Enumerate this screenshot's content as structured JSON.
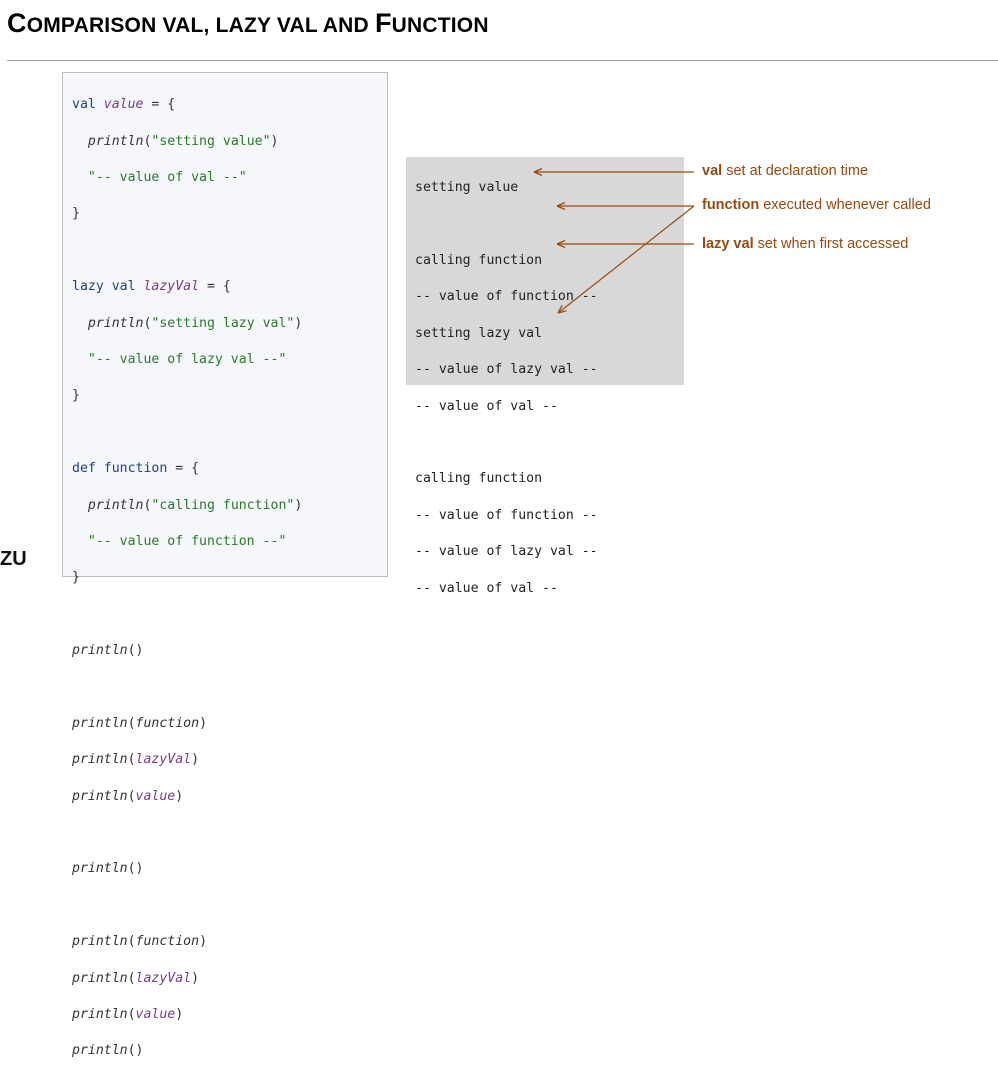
{
  "title": {
    "first": "C",
    "rest1": "OMPARISON VAL, LAZY VAL AND ",
    "mid": "F",
    "rest2": "UNCTION"
  },
  "code": {
    "val_decl": {
      "kw": "val",
      "name": "value",
      "eq": " = {"
    },
    "val_print": {
      "fn": "println",
      "arg": "\"setting value\""
    },
    "val_str": "\"-- value of val --\"",
    "lazy_decl": {
      "kw": "lazy val",
      "name": "lazyVal",
      "eq": " = {"
    },
    "lazy_print": {
      "fn": "println",
      "arg": "\"setting lazy val\""
    },
    "lazy_str": "\"-- value of lazy val --\"",
    "def_decl": {
      "kw": "def",
      "name": "function",
      "eq": " = {"
    },
    "def_print": {
      "fn": "println",
      "arg": "\"calling function\""
    },
    "def_str": "\"-- value of function --\"",
    "close": "}",
    "println": "println",
    "arg_function": "function",
    "arg_lazy": "lazyVal",
    "arg_value": "value"
  },
  "output": [
    "setting value",
    "",
    "calling function",
    "-- value of function --",
    "setting lazy val",
    "-- value of lazy val --",
    "-- value of val --",
    "",
    "calling function",
    "-- value of function --",
    "-- value of lazy val --",
    "-- value of val --"
  ],
  "annotations": {
    "val": {
      "keyword": "val",
      "text": " set at declaration time"
    },
    "function": {
      "keyword": "function",
      "text": " executed whenever called"
    },
    "lazy": {
      "keyword": "lazy val",
      "text": " set when first accessed"
    }
  },
  "logo": "ZU",
  "colors": {
    "annotation": "#9a4a10",
    "keyword": "#1f3f85",
    "string": "#2a7a2a",
    "variable": "#7a3b8f"
  }
}
